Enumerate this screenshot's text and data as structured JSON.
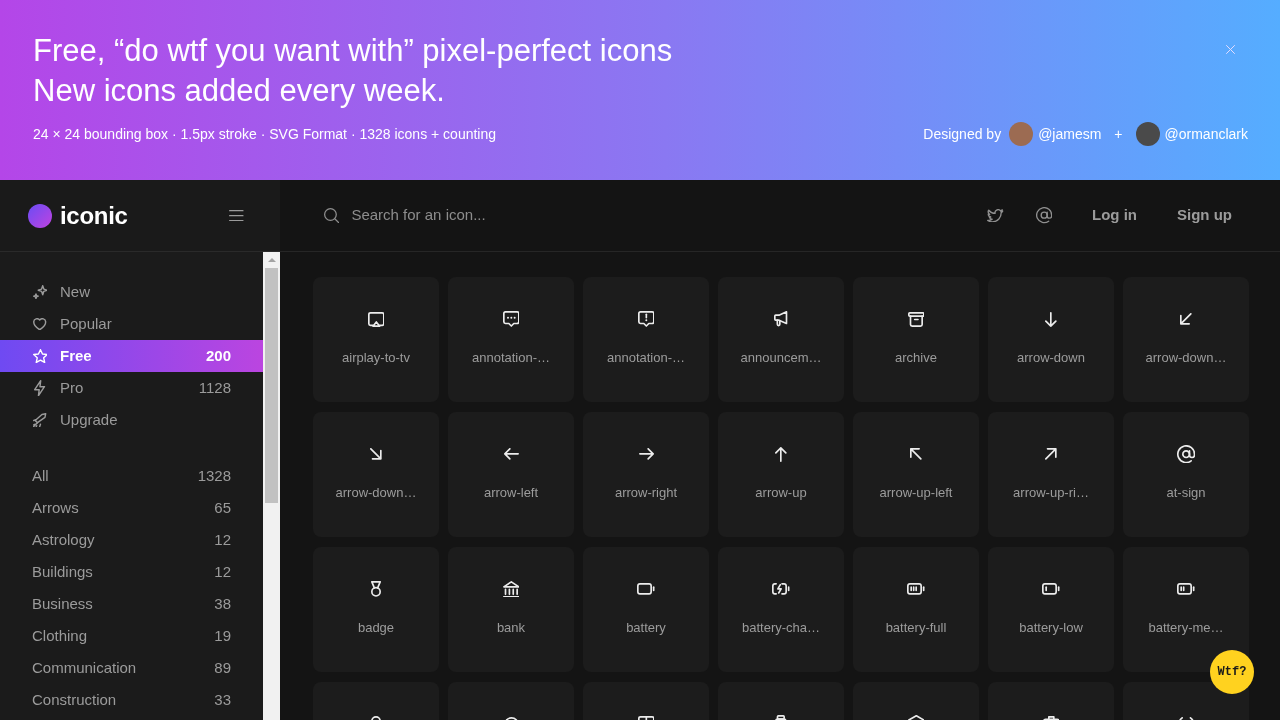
{
  "banner": {
    "headlines": [
      "Free, “do wtf you want with” pixel-perfect icons",
      "New icons added every week."
    ],
    "subtitle": "24 × 24 bounding box · 1.5px stroke · SVG Format · 1328 icons + counting",
    "credits": {
      "label": "Designed by",
      "separator": "+",
      "designers": [
        {
          "handle": "@jamesm"
        },
        {
          "handle": "@ormanclark"
        }
      ]
    }
  },
  "sidebar": {
    "logo": "iconic",
    "nav": [
      {
        "label": "New",
        "selected": false
      },
      {
        "label": "Popular",
        "selected": false
      },
      {
        "label": "Free",
        "count": "200",
        "selected": true
      },
      {
        "label": "Pro",
        "count": "1128",
        "selected": false
      },
      {
        "label": "Upgrade",
        "selected": false
      }
    ],
    "categories": [
      {
        "label": "All",
        "count": "1328",
        "selected": false
      },
      {
        "label": "Arrows",
        "count": "65",
        "selected": false
      },
      {
        "label": "Astrology",
        "count": "12",
        "selected": false
      },
      {
        "label": "Buildings",
        "count": "12",
        "selected": false
      },
      {
        "label": "Business",
        "count": "38",
        "selected": false
      },
      {
        "label": "Clothing",
        "count": "19",
        "selected": false
      },
      {
        "label": "Communication",
        "count": "89",
        "selected": false
      },
      {
        "label": "Construction",
        "count": "33",
        "selected": false
      }
    ]
  },
  "topbar": {
    "search": {
      "placeholder": "Search for an icon..."
    },
    "links": [
      "Log in",
      "Sign up"
    ]
  },
  "icons": [
    {
      "kind": "labelled",
      "label": "airplay-to-tv"
    },
    {
      "kind": "labelled",
      "label": "annotation-…"
    },
    {
      "kind": "labelled",
      "label": "annotation-…"
    },
    {
      "kind": "labelled",
      "label": "announcem…"
    },
    {
      "kind": "labelled",
      "label": "archive"
    },
    {
      "kind": "labelled",
      "label": "arrow-down"
    },
    {
      "kind": "labelled",
      "label": "arrow-down…"
    },
    {
      "kind": "labelled",
      "label": "arrow-down…"
    },
    {
      "kind": "labelled",
      "label": "arrow-left"
    },
    {
      "kind": "labelled",
      "label": "arrow-right"
    },
    {
      "kind": "labelled",
      "label": "arrow-up"
    },
    {
      "kind": "labelled",
      "label": "arrow-up-left"
    },
    {
      "kind": "labelled",
      "label": "arrow-up-ri…"
    },
    {
      "kind": "labelled",
      "label": "at-sign"
    },
    {
      "kind": "labelled",
      "label": "badge"
    },
    {
      "kind": "labelled",
      "label": "bank"
    },
    {
      "kind": "labelled",
      "label": "battery"
    },
    {
      "kind": "labelled",
      "label": "battery-cha…"
    },
    {
      "kind": "labelled",
      "label": "battery-full"
    },
    {
      "kind": "labelled",
      "label": "battery-low"
    },
    {
      "kind": "labelled",
      "label": "battery-me…"
    },
    {
      "kind": "clipped"
    },
    {
      "kind": "clipped"
    },
    {
      "kind": "clipped"
    },
    {
      "kind": "clipped"
    },
    {
      "kind": "clipped"
    },
    {
      "kind": "clipped"
    },
    {
      "kind": "clipped"
    }
  ],
  "help_button": {
    "label": "Wtf?"
  }
}
